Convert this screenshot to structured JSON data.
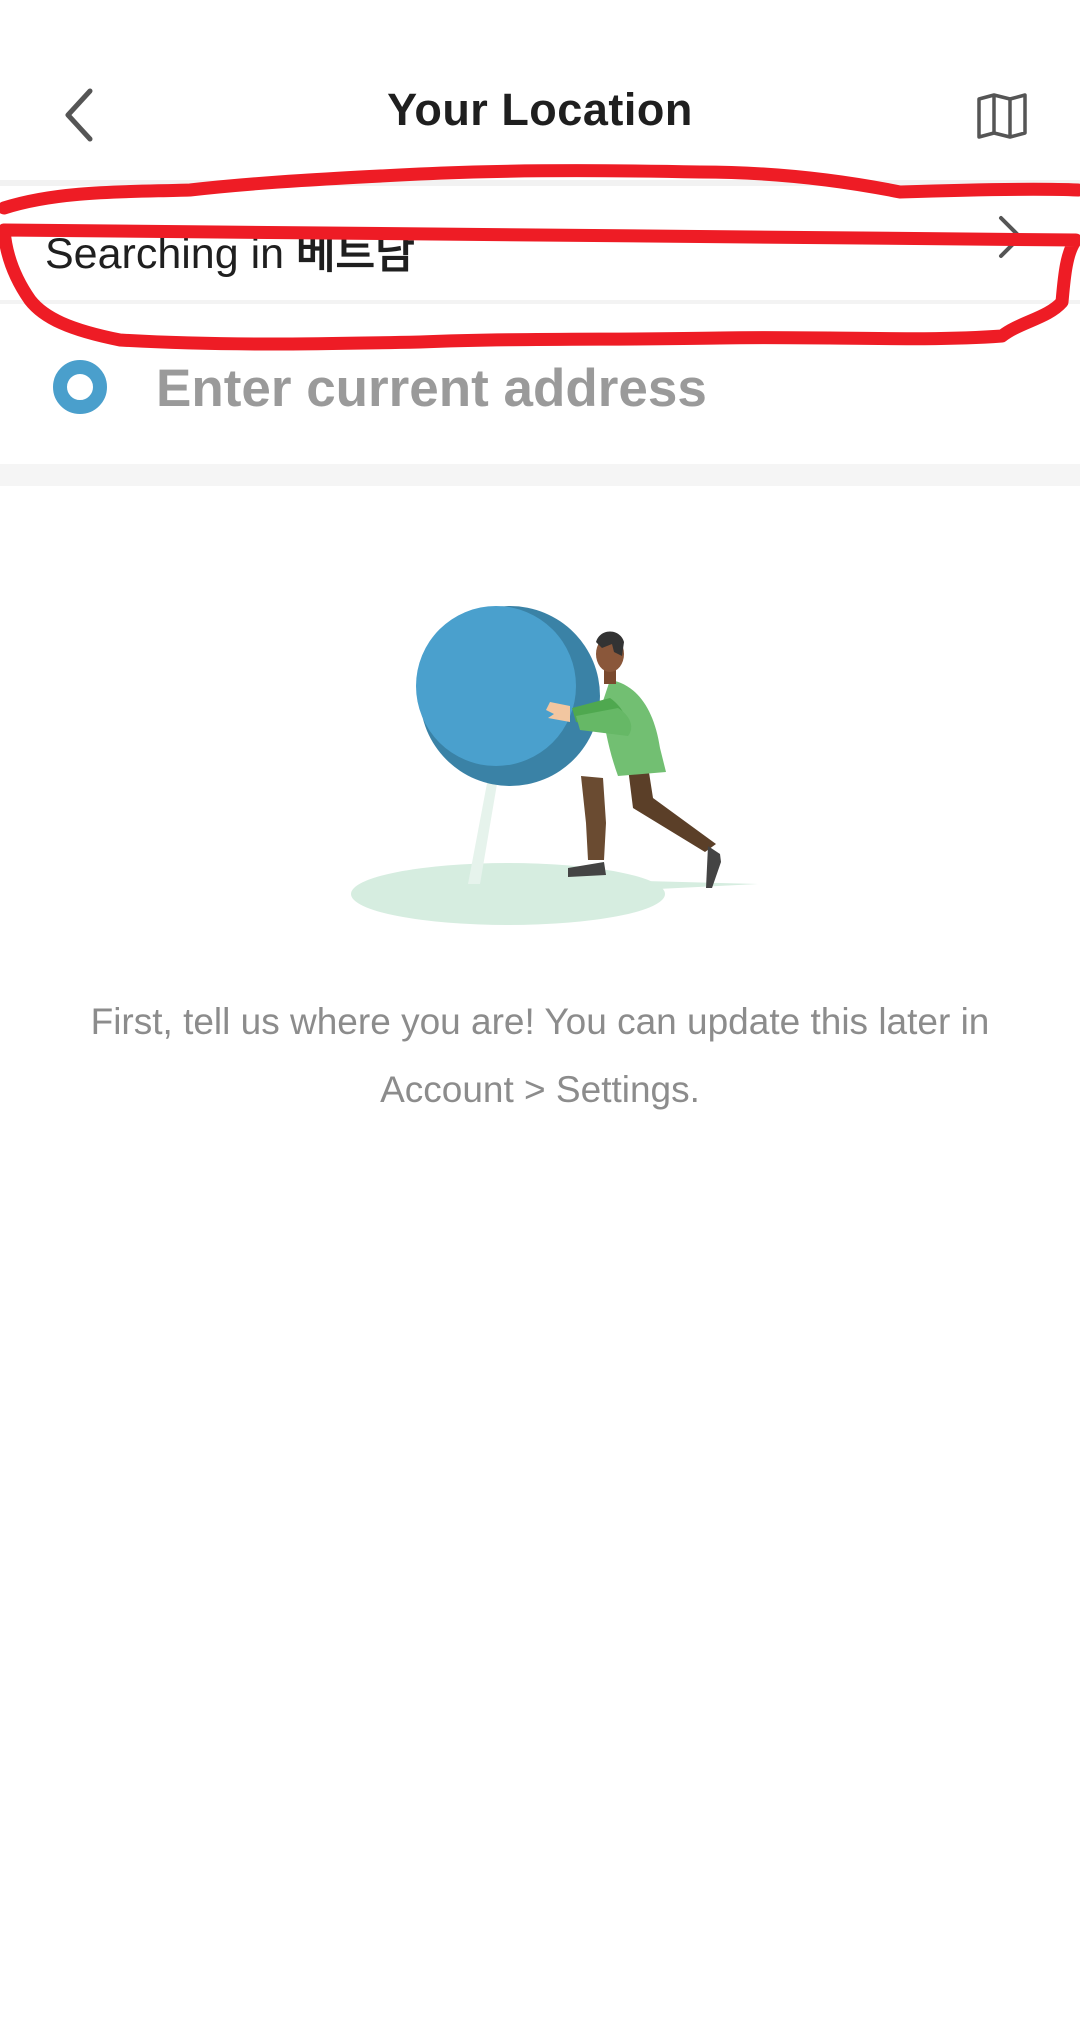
{
  "header": {
    "title": "Your Location",
    "back_icon": "chevron-left-icon",
    "map_icon": "map-icon"
  },
  "country_selector": {
    "prefix": "Searching in",
    "country": "베트남",
    "chevron_icon": "chevron-right-icon"
  },
  "address": {
    "placeholder": "Enter current address",
    "value": "",
    "icon": "location-dot-icon"
  },
  "hint": {
    "line1": "First, tell us where you are! You can update this later in",
    "line2": "Account > Settings."
  },
  "colors": {
    "accent": "#4a9fcc",
    "accent_dark": "#3a82a6",
    "annotation": "#ee1c25",
    "title": "#1f1f1f",
    "muted": "#8c8c8c"
  }
}
